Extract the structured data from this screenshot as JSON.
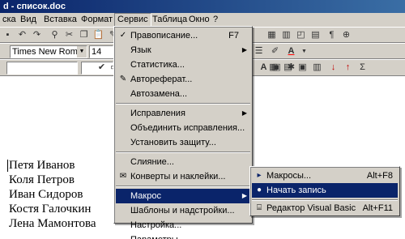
{
  "window": {
    "title": "d - список.doc"
  },
  "menubar": {
    "items": [
      {
        "label": "ска"
      },
      {
        "label": "Вид"
      },
      {
        "label": "Вставка"
      },
      {
        "label": "Формат"
      },
      {
        "label": "Сервис"
      },
      {
        "label": "Таблица"
      },
      {
        "label": "Окно"
      },
      {
        "label": "?"
      }
    ],
    "active": "Сервис"
  },
  "format_toolbar": {
    "font": "Times New Roman",
    "size": "14"
  },
  "service_menu": {
    "items": [
      {
        "label": "Правописание...",
        "shortcut": "F7",
        "icon": "spellcheck-icon"
      },
      {
        "label": "Язык",
        "submenu": "▶"
      },
      {
        "label": "Статистика..."
      },
      {
        "label": "Автореферат...",
        "icon": "autosummarize-icon"
      },
      {
        "label": "Автозамена..."
      },
      {
        "label": "Исправления",
        "submenu": "▶"
      },
      {
        "label": "Объединить исправления..."
      },
      {
        "label": "Установить защиту..."
      },
      {
        "label": "Слияние..."
      },
      {
        "label": "Конверты и наклейки...",
        "icon": "envelope-icon"
      },
      {
        "label": "Макрос",
        "submenu": "▶",
        "highlighted": true
      },
      {
        "label": "Шаблоны и надстройки..."
      },
      {
        "label": "Настройка..."
      },
      {
        "label": "Параметры..."
      }
    ]
  },
  "macro_submenu": {
    "items": [
      {
        "label": "Макросы...",
        "shortcut": "Alt+F8",
        "icon": "play-icon"
      },
      {
        "label": "Начать запись",
        "icon": "record-icon",
        "highlighted": true
      },
      {
        "label": "Редактор Visual Basic",
        "shortcut": "Alt+F11",
        "icon": "vb-editor-icon"
      }
    ]
  },
  "document": {
    "lines": [
      "Петя Иванов",
      "Коля Петров",
      "Иван Сидоров",
      "Костя Галочкин",
      "Лена Мамонтова"
    ]
  },
  "colors": {
    "highlight": "#0a246a",
    "face": "#d4d0c8"
  }
}
